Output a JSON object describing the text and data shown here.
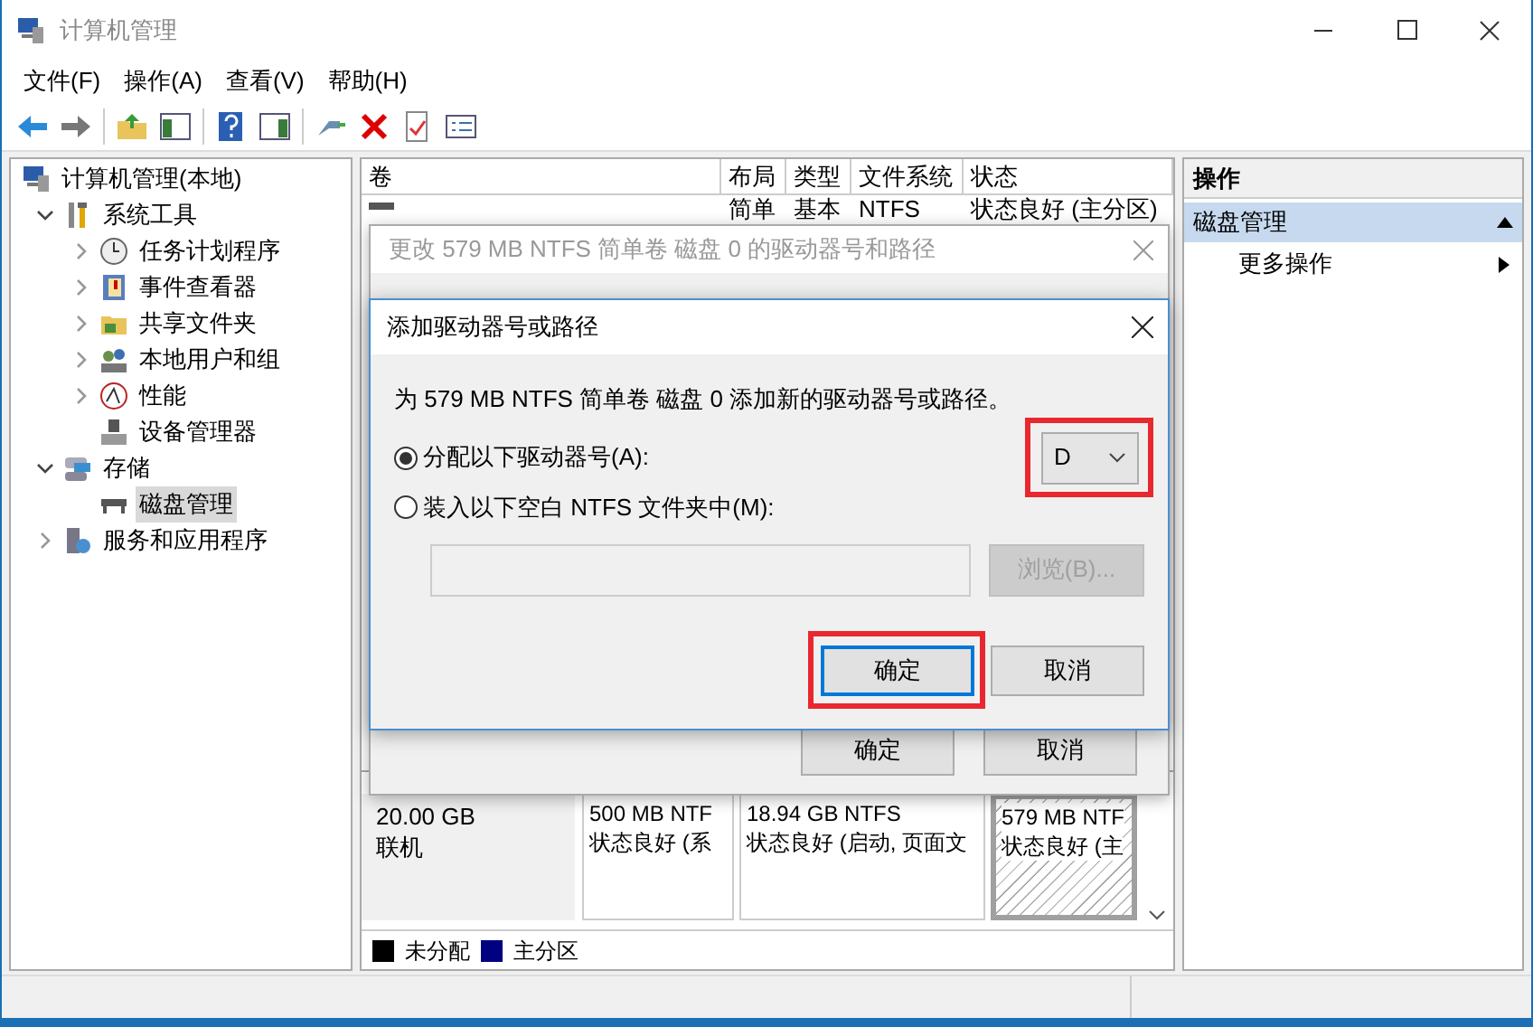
{
  "window": {
    "title": "计算机管理"
  },
  "menu": [
    "文件(F)",
    "操作(A)",
    "查看(V)",
    "帮助(H)"
  ],
  "tree": [
    {
      "label": "计算机管理(本地)",
      "kind": "computer",
      "selected": false,
      "children": [
        {
          "label": "系统工具",
          "kind": "tools",
          "expandable": true,
          "expanded": true,
          "selected": false,
          "children": [
            {
              "label": "任务计划程序",
              "kind": "clock",
              "expandable": true,
              "expanded": false,
              "selected": false
            },
            {
              "label": "事件查看器",
              "kind": "log",
              "expandable": true,
              "expanded": false,
              "selected": false
            },
            {
              "label": "共享文件夹",
              "kind": "folder",
              "expandable": true,
              "expanded": false,
              "selected": false
            },
            {
              "label": "本地用户和组",
              "kind": "users",
              "expandable": true,
              "expanded": false,
              "selected": false
            },
            {
              "label": "性能",
              "kind": "performance",
              "expandable": true,
              "expanded": false,
              "selected": false
            },
            {
              "label": "设备管理器",
              "kind": "device",
              "expandable": false,
              "selected": false
            }
          ]
        },
        {
          "label": "存储",
          "kind": "storage",
          "expandable": true,
          "expanded": true,
          "selected": false,
          "children": [
            {
              "label": "磁盘管理",
              "kind": "disk",
              "expandable": false,
              "selected": true
            }
          ]
        },
        {
          "label": "服务和应用程序",
          "kind": "services",
          "expandable": true,
          "expanded": false,
          "selected": false
        }
      ]
    }
  ],
  "table": {
    "columns": [
      "卷",
      "布局",
      "类型",
      "文件系统",
      "状态"
    ],
    "rows": [
      {
        "layout": "简单",
        "type": "基本",
        "file_system": "NTFS",
        "status": "状态良好 (主分区)"
      }
    ]
  },
  "disk": {
    "size": "20.00 GB",
    "status": "联机",
    "partitions": [
      {
        "size": "500 MB NTF",
        "status": "状态良好 (系",
        "selected": false
      },
      {
        "size": "18.94 GB NTFS",
        "status": "状态良好 (启动, 页面文",
        "selected": false
      },
      {
        "size": "579 MB NTF",
        "status": "状态良好 (主",
        "selected": true
      }
    ]
  },
  "legend": [
    {
      "label": "未分配",
      "color": "#000000"
    },
    {
      "label": "主分区",
      "color": "#000080"
    }
  ],
  "actions": {
    "header": "操作",
    "section": {
      "label": "磁盘管理",
      "expanded": true
    },
    "items": [
      {
        "label": "更多操作"
      }
    ]
  },
  "back_dialog": {
    "title": "更改 579 MB NTFS 简单卷 磁盘 0 的驱动器号和路径",
    "active": false,
    "buttons": [
      "确定",
      "取消"
    ]
  },
  "dialog": {
    "title": "添加驱动器号或路径",
    "description": "为 579 MB NTFS 简单卷 磁盘 0 添加新的驱动器号或路径。",
    "options": [
      {
        "label": "分配以下驱动器号(A):",
        "selected": true
      },
      {
        "label": "装入以下空白 NTFS 文件夹中(M):",
        "selected": false
      }
    ],
    "drive_letter": {
      "value": "D",
      "highlighted": true
    },
    "folder_path": {
      "disabled": true
    },
    "browse_button": {
      "label": "浏览(B)...",
      "disabled": true
    },
    "buttons": [
      {
        "label": "确定",
        "default": true,
        "highlighted": true
      },
      {
        "label": "取消",
        "default": false,
        "highlighted": false
      }
    ]
  }
}
